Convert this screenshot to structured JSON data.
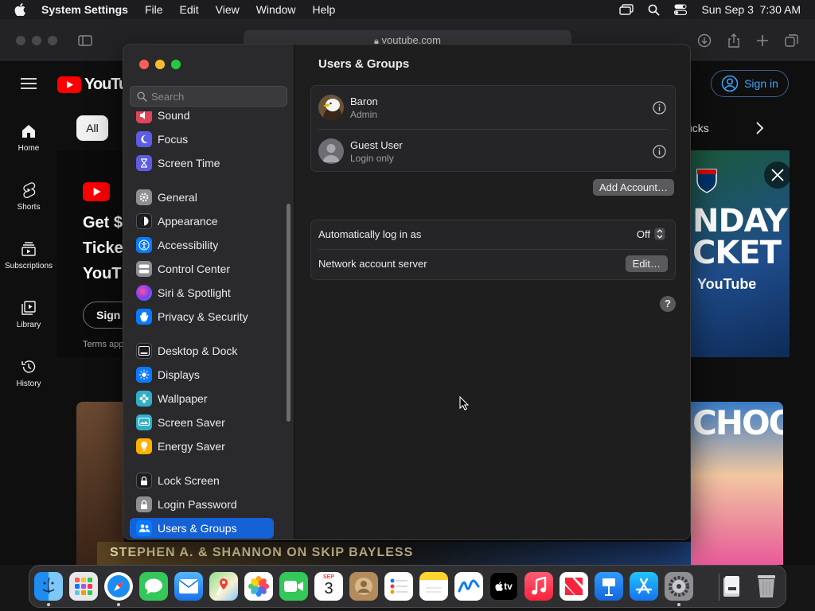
{
  "menubar": {
    "app_name": "System Settings",
    "menus": [
      "File",
      "Edit",
      "View",
      "Window",
      "Help"
    ],
    "clock": "Sun Sep 3  7:30 AM",
    "icons": [
      "apple-logo",
      "screen-mirroring-icon",
      "spotlight-search-icon",
      "control-center-icon"
    ]
  },
  "browser": {
    "url": "youtube.com",
    "youtube": {
      "logo_text": "YouTube",
      "sign_in_label": "Sign in",
      "nav": [
        "Home",
        "Shorts",
        "Subscriptions",
        "Library",
        "History"
      ],
      "chip_all": "All",
      "chip_partial": "ucks",
      "promo_lines": [
        "Get $",
        "Ticke",
        "YouT"
      ],
      "promo_button": "Sign u",
      "promo_terms": "Terms app",
      "ad_lines": [
        "NDAY",
        "CKET"
      ],
      "ad_brand": "YouTube",
      "right_thumb_text": "CHOOL",
      "bottom_caption": "STEPHEN A. & SHANNON ON SKIP BAYLESS"
    }
  },
  "settings": {
    "search_placeholder": "Search",
    "sidebar_items": [
      {
        "label": "Sound",
        "icon": "sound-icon",
        "color": "#e0445a"
      },
      {
        "label": "Focus",
        "icon": "focus-moon-icon",
        "color": "#5e5ce6"
      },
      {
        "label": "Screen Time",
        "icon": "hourglass-icon",
        "color": "#5e5ce6"
      },
      {
        "label": "General",
        "icon": "gear-icon",
        "color": "#8e8e93"
      },
      {
        "label": "Appearance",
        "icon": "appearance-icon",
        "color": "#1c1c1e"
      },
      {
        "label": "Accessibility",
        "icon": "accessibility-icon",
        "color": "#0a7aff"
      },
      {
        "label": "Control Center",
        "icon": "control-center-icon",
        "color": "#8e8e93"
      },
      {
        "label": "Siri & Spotlight",
        "icon": "siri-icon",
        "color": "#b23dd6"
      },
      {
        "label": "Privacy & Security",
        "icon": "hand-icon",
        "color": "#0a7aff"
      },
      {
        "label": "Desktop & Dock",
        "icon": "dock-icon",
        "color": "#1c1c1e"
      },
      {
        "label": "Displays",
        "icon": "sun-icon",
        "color": "#0a7aff"
      },
      {
        "label": "Wallpaper",
        "icon": "flower-icon",
        "color": "#30b0c7"
      },
      {
        "label": "Screen Saver",
        "icon": "screen-saver-icon",
        "color": "#30b0c7"
      },
      {
        "label": "Energy Saver",
        "icon": "lightbulb-icon",
        "color": "#ffb000"
      },
      {
        "label": "Lock Screen",
        "icon": "lock-icon",
        "color": "#1c1c1e"
      },
      {
        "label": "Login Password",
        "icon": "lock-icon",
        "color": "#8e8e93"
      },
      {
        "label": "Users & Groups",
        "icon": "users-icon",
        "color": "#0a7aff"
      }
    ],
    "selected_item": "Users & Groups",
    "page_title": "Users & Groups",
    "users": [
      {
        "name": "Baron",
        "role": "Admin",
        "avatar": "eagle-avatar"
      },
      {
        "name": "Guest User",
        "role": "Login only",
        "avatar": "generic-person-avatar"
      }
    ],
    "add_account_label": "Add Account…",
    "auto_login_label": "Automatically log in as",
    "auto_login_value": "Off",
    "network_server_label": "Network account server",
    "edit_label": "Edit…",
    "help_label": "?"
  },
  "dock": {
    "apps": [
      "Finder",
      "Launchpad",
      "Safari",
      "Messages",
      "Mail",
      "Maps",
      "Photos",
      "FaceTime",
      "Calendar",
      "Contacts",
      "Reminders",
      "Notes",
      "Freeform",
      "TV",
      "Music",
      "News",
      "Keynote",
      "App Store",
      "System Settings",
      "Downloads",
      "Trash"
    ],
    "calendar_month": "SEP",
    "calendar_day": "3",
    "tv_label": "tv"
  }
}
